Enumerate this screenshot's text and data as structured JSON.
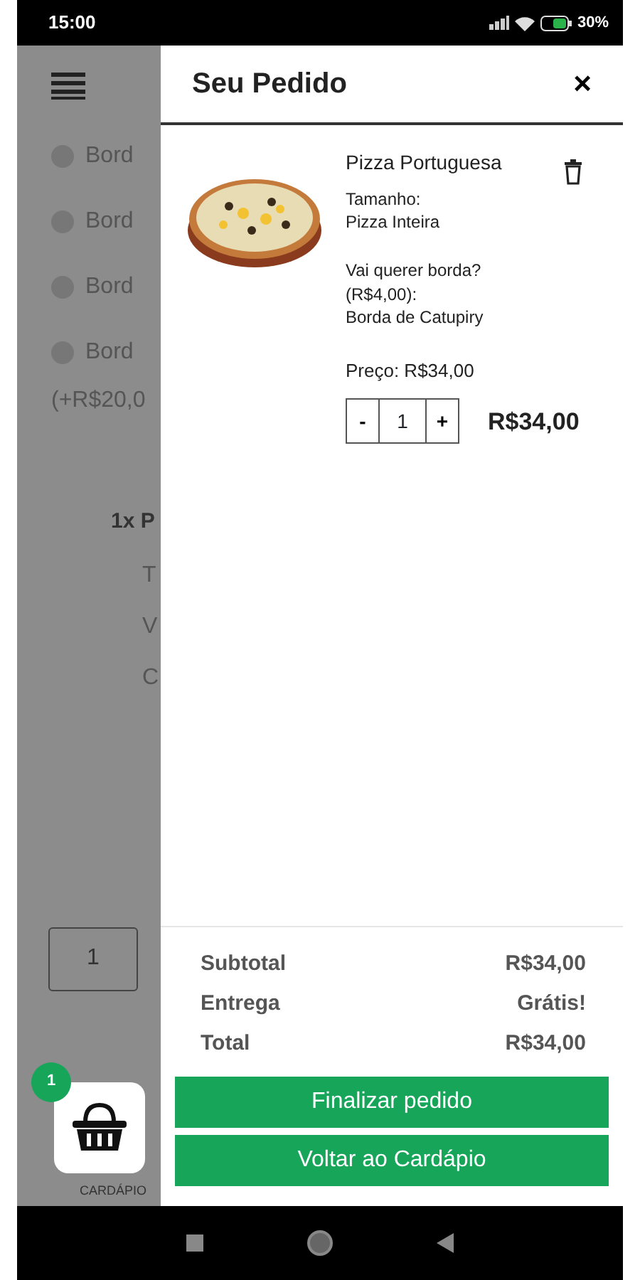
{
  "status_bar": {
    "time": "15:00",
    "battery": "30%"
  },
  "background": {
    "options": [
      {
        "label": "Bord",
        "selected": false
      },
      {
        "label": "Bord",
        "selected": false
      },
      {
        "label": "Bord",
        "selected": false
      },
      {
        "label": "Bord",
        "selected": false
      }
    ],
    "option_note": "(+R$20,0",
    "order_line": "1x P",
    "detail_lines": [
      "T",
      "V",
      "C"
    ],
    "quantity": "1",
    "cart": {
      "badge": "1",
      "label": "CARDÁPIO"
    }
  },
  "drawer": {
    "title": "Seu Pedido",
    "close": "×",
    "items": [
      {
        "name": "Pizza Portuguesa",
        "size_label": "Tamanho:",
        "size": "Pizza Inteira",
        "extra_lines": [
          "Vai querer borda?",
          "(R$4,00):"
        ],
        "extra": "Borda de Catupiry",
        "price": "Preço: R$34,00",
        "minus": "-",
        "quantity": "1",
        "plus": "+",
        "line_total": "R$34,00"
      }
    ],
    "summary": [
      {
        "label": "Subtotal",
        "value": "R$34,00"
      },
      {
        "label": "Entrega",
        "value": "Grátis!"
      },
      {
        "label": "Total",
        "value": "R$34,00"
      }
    ],
    "buttons": [
      "Finalizar pedido",
      "Voltar ao Cardápio"
    ]
  }
}
